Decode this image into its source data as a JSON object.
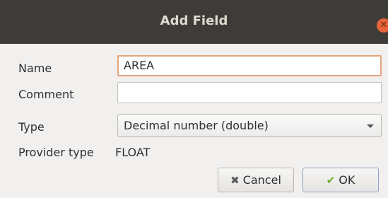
{
  "dialog": {
    "title": "Add Field",
    "close_icon": "close-icon",
    "fields": {
      "name_label": "Name",
      "name_value": "AREA",
      "comment_label": "Comment",
      "comment_value": "",
      "type_label": "Type",
      "type_value": "Decimal number (double)",
      "provider_label": "Provider type",
      "provider_value": "FLOAT"
    },
    "buttons": {
      "cancel_label": "Cancel",
      "ok_label": "OK"
    }
  },
  "colors": {
    "titlebar": "#3d3c38",
    "close_button": "#e8643a",
    "focus_border": "#e3a57e",
    "check_icon": "#6cab2a"
  }
}
